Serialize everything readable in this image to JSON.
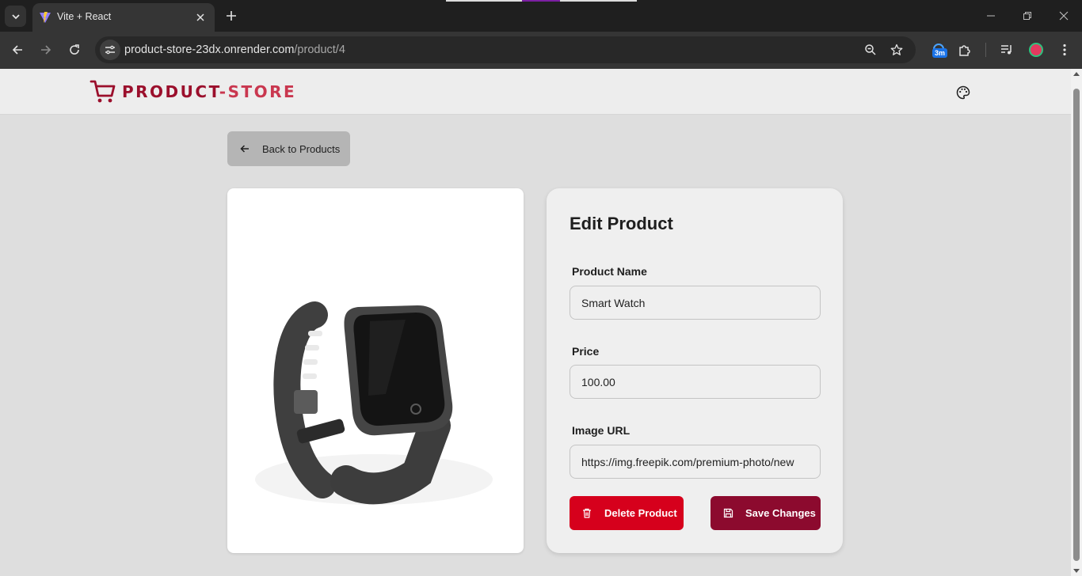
{
  "browser": {
    "tab_title": "Vite + React",
    "url_host": "product-store-23dx.onrender.com",
    "url_path": "/product/4",
    "extension_badge": "3m"
  },
  "navbar": {
    "brand_part1": "PRODUCT",
    "brand_part2": "-STORE"
  },
  "page": {
    "back_label": "Back to Products"
  },
  "edit": {
    "title": "Edit Product",
    "name_label": "Product Name",
    "name_value": "Smart Watch",
    "price_label": "Price",
    "price_value": "100.00",
    "image_label": "Image URL",
    "image_value": "https://img.freepik.com/premium-photo/new",
    "delete_label": "Delete Product",
    "save_label": "Save Changes"
  },
  "colors": {
    "brand_dark": "#9b0f2c",
    "brand_light": "#c9374f",
    "delete": "#d6001c",
    "save": "#8c0a2e"
  },
  "icons": [
    "chevron-down-icon",
    "vite-icon",
    "close-icon",
    "plus-icon",
    "minimize-icon",
    "restore-icon",
    "back-arrow-icon",
    "forward-arrow-icon",
    "reload-icon",
    "site-settings-icon",
    "zoom-icon",
    "star-icon",
    "extension-icon",
    "puzzle-icon",
    "media-icon",
    "menu-icon",
    "cart-icon",
    "palette-icon",
    "arrow-left-icon",
    "trash-icon",
    "save-icon"
  ]
}
